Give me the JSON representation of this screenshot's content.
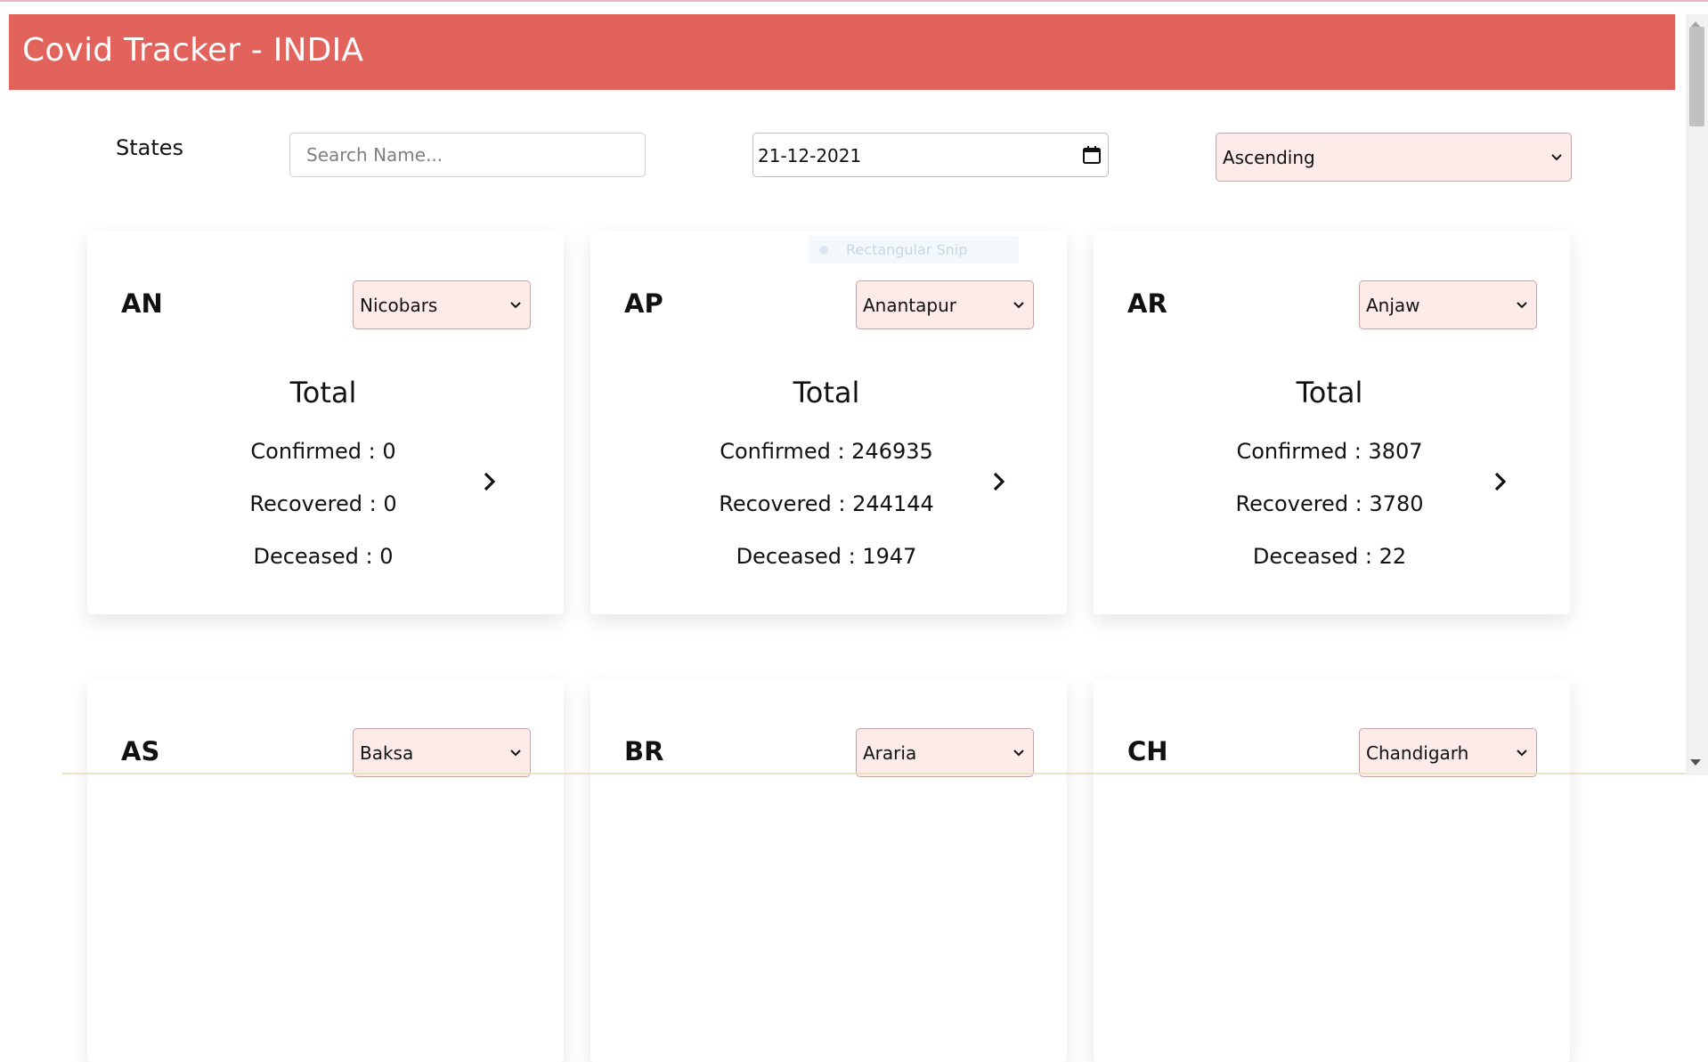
{
  "header": {
    "title": "Covid Tracker - INDIA"
  },
  "filters": {
    "states_label": "States",
    "search_placeholder": "Search Name...",
    "date_value": "21-12-2021",
    "sort_value": "Ascending"
  },
  "overlay": {
    "snip_label": "Rectangular Snip"
  },
  "cards": [
    {
      "code": "AN",
      "district": "Nicobars",
      "total_label": "Total",
      "confirmed_label": "Confirmed : ",
      "confirmed": "0",
      "recovered_label": "Recovered : ",
      "recovered": "0",
      "deceased_label": "Deceased : ",
      "deceased": "0"
    },
    {
      "code": "AP",
      "district": "Anantapur",
      "total_label": "Total",
      "confirmed_label": "Confirmed : ",
      "confirmed": "246935",
      "recovered_label": "Recovered : ",
      "recovered": "244144",
      "deceased_label": "Deceased : ",
      "deceased": "1947"
    },
    {
      "code": "AR",
      "district": "Anjaw",
      "total_label": "Total",
      "confirmed_label": "Confirmed : ",
      "confirmed": "3807",
      "recovered_label": "Recovered : ",
      "recovered": "3780",
      "deceased_label": "Deceased : ",
      "deceased": "22"
    },
    {
      "code": "AS",
      "district": "Baksa"
    },
    {
      "code": "BR",
      "district": "Araria"
    },
    {
      "code": "CH",
      "district": "Chandigarh"
    }
  ],
  "colors": {
    "header_bg": "#e2625c",
    "select_bg": "#fdebea",
    "select_border": "#c7a3a3"
  }
}
